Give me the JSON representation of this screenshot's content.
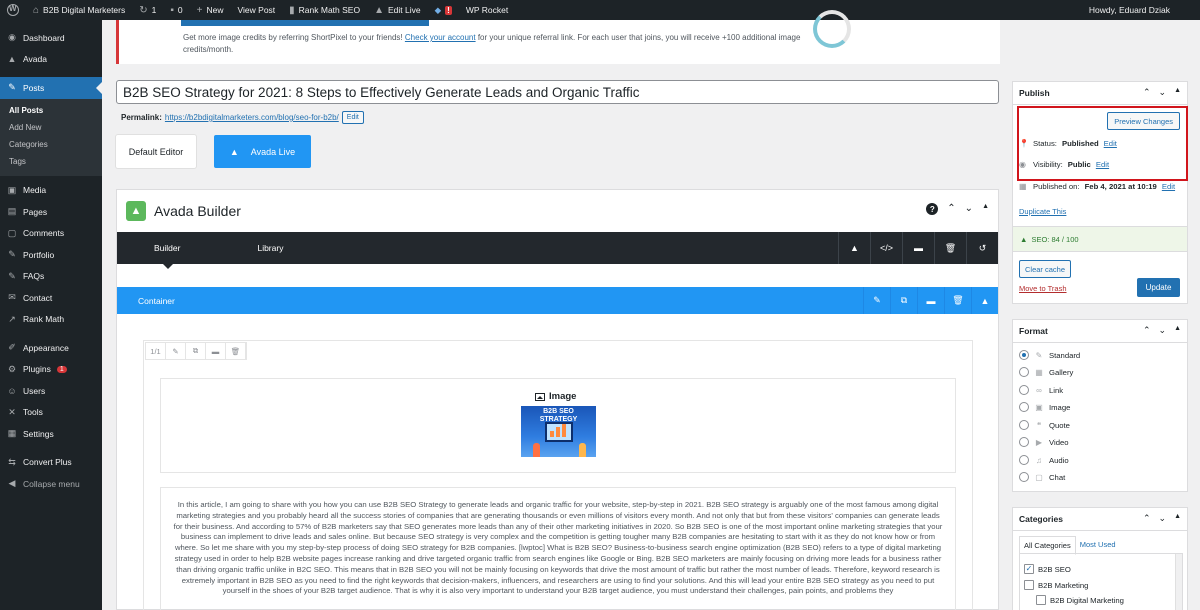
{
  "adminbar": {
    "site_name": "B2B Digital Marketers",
    "updates_count": "1",
    "comments_count": "0",
    "new_label": "New",
    "view_post": "View Post",
    "rank_math": "Rank Math SEO",
    "edit_live": "Edit Live",
    "wp_rocket": "WP Rocket",
    "howdy": "Howdy, Eduard Dziak",
    "alert_mark": "!"
  },
  "sidebar": {
    "items": [
      {
        "label": "Dashboard",
        "icon": "dashboard-icon",
        "glyph": "◉"
      },
      {
        "label": "Avada",
        "icon": "avada-icon",
        "glyph": "▲"
      },
      {
        "label": "Posts",
        "icon": "pin-icon",
        "glyph": "✎"
      },
      {
        "label": "Media",
        "icon": "media-icon",
        "glyph": "▣"
      },
      {
        "label": "Pages",
        "icon": "pages-icon",
        "glyph": "▤"
      },
      {
        "label": "Comments",
        "icon": "comments-icon",
        "glyph": "▢"
      },
      {
        "label": "Portfolio",
        "icon": "portfolio-icon",
        "glyph": "✎"
      },
      {
        "label": "FAQs",
        "icon": "faq-icon",
        "glyph": "✎"
      },
      {
        "label": "Contact",
        "icon": "mail-icon",
        "glyph": "✉"
      },
      {
        "label": "Rank Math",
        "icon": "rankmath-icon",
        "glyph": "↗"
      },
      {
        "label": "Appearance",
        "icon": "brush-icon",
        "glyph": "✐"
      },
      {
        "label": "Plugins",
        "icon": "plugin-icon",
        "glyph": "⚙"
      },
      {
        "label": "Users",
        "icon": "users-icon",
        "glyph": "☺"
      },
      {
        "label": "Tools",
        "icon": "wrench-icon",
        "glyph": "✕"
      },
      {
        "label": "Settings",
        "icon": "settings-icon",
        "glyph": "▦"
      },
      {
        "label": "Convert Plus",
        "icon": "convert-icon",
        "glyph": "⇆"
      },
      {
        "label": "Collapse menu",
        "icon": "collapse-icon",
        "glyph": "◀"
      }
    ],
    "posts_submenu": [
      "All Posts",
      "Add New",
      "Categories",
      "Tags"
    ],
    "plugins_count": "1"
  },
  "notice": {
    "text_before": "Get more image credits by referring ShortPixel to your friends!",
    "link": "Check your account",
    "text_after": "for your unique referral link. For each user that joins, you will receive +100 additional image credits/month."
  },
  "post": {
    "title": "B2B SEO Strategy for 2021: 8 Steps to Effectively Generate Leads and Organic Traffic",
    "permalink_label": "Permalink:",
    "permalink_url": "https://b2bdigitalmarketers.com/blog/seo-for-b2b/",
    "permalink_edit": "Edit"
  },
  "editor_switch": {
    "default": "Default Editor",
    "live": "Avada Live"
  },
  "builder": {
    "title": "Avada Builder",
    "tabs": [
      "Builder",
      "Library"
    ],
    "container_label": "Container",
    "column_size": "1/1",
    "image_label": "Image",
    "thumb_title": "B2B SEO STRATEGY",
    "body_text": "In this article, I am going to share with you how you can use B2B SEO Strategy to generate leads and organic traffic for your website, step-by-step in 2021. B2B SEO strategy is arguably one of the most famous among digital marketing strategies and you probably heard all the success stories of companies that are generating thousands or even millions of visitors every month. And not only that but from these visitors' companies can generate leads for their business. And according to 57% of B2B marketers say that SEO generates more leads than any of their other marketing initiatives in 2020. So B2B SEO is one of the most important online marketing strategies that your business can implement to drive leads and sales online. But because SEO strategy is very complex and the competition is getting tougher many B2B companies are hesitating to start with it as they do not know how or from where. So let me share with you my step-by-step process of doing SEO strategy for B2B companies. [lwptoc] What is B2B SEO? Business-to-business search engine optimization (B2B SEO) refers to a type of digital marketing strategy used in order to help B2B website pages increase ranking and drive targeted organic traffic from search engines like Google or Bing. B2B SEO marketers are mainly focusing on driving more leads for a business rather than driving organic traffic unlike in B2C SEO. This means that in B2B SEO you will not be mainly focusing on keywords that drive the most amount of traffic but rather the most number of leads. Therefore, keyword research is extremely important in B2B SEO as you need to find the right keywords that decision-makers, influencers, and researchers are using to find your solutions. And this will lead your entire B2B SEO strategy as you need to put yourself in the shoes of your B2B target audience. That is why it is also very important to understand your B2B target audience, you must understand their challenges, pain points, and problems they"
  },
  "publish": {
    "title": "Publish",
    "preview_button": "Preview Changes",
    "status_label": "Status:",
    "status_value": "Published",
    "visibility_label": "Visibility:",
    "visibility_value": "Public",
    "published_label": "Published on:",
    "published_value": "Feb 4, 2021 at 10:19",
    "edit_link": "Edit",
    "duplicate": "Duplicate This",
    "seo_score": "SEO: 84 / 100",
    "clear_cache": "Clear cache",
    "trash": "Move to Trash",
    "update": "Update"
  },
  "format": {
    "title": "Format",
    "options": [
      {
        "label": "Standard",
        "icon": "pin-icon",
        "glyph": "✎",
        "selected": true
      },
      {
        "label": "Gallery",
        "icon": "gallery-icon",
        "glyph": "▦",
        "selected": false
      },
      {
        "label": "Link",
        "icon": "link-icon",
        "glyph": "∞",
        "selected": false
      },
      {
        "label": "Image",
        "icon": "image-icon",
        "glyph": "▣",
        "selected": false
      },
      {
        "label": "Quote",
        "icon": "quote-icon",
        "glyph": "❝",
        "selected": false
      },
      {
        "label": "Video",
        "icon": "video-icon",
        "glyph": "▶",
        "selected": false
      },
      {
        "label": "Audio",
        "icon": "audio-icon",
        "glyph": "♫",
        "selected": false
      },
      {
        "label": "Chat",
        "icon": "chat-icon",
        "glyph": "▢",
        "selected": false
      }
    ]
  },
  "categories": {
    "title": "Categories",
    "tab_all": "All Categories",
    "tab_used": "Most Used",
    "items": [
      {
        "label": "B2B SEO",
        "checked": true
      },
      {
        "label": "B2B Marketing",
        "checked": false
      },
      {
        "label": "B2B Digital Marketing",
        "checked": false
      }
    ]
  },
  "colors": {
    "admin_dark": "#1d2327",
    "wp_blue": "#2271b1",
    "avada_blue": "#2196f3",
    "highlight_red": "#d1151c",
    "avada_green": "#5cb85c"
  }
}
